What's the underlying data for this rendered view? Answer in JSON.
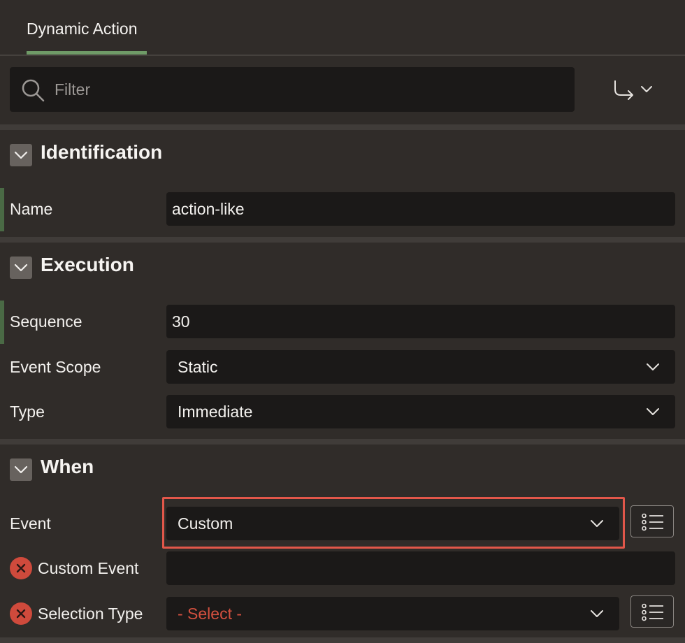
{
  "tabs": {
    "active_label": "Dynamic Action"
  },
  "filter": {
    "placeholder": "Filter"
  },
  "sections": {
    "identification": {
      "title": "Identification",
      "name": {
        "label": "Name",
        "value": "action-like"
      }
    },
    "execution": {
      "title": "Execution",
      "sequence": {
        "label": "Sequence",
        "value": "30"
      },
      "event_scope": {
        "label": "Event Scope",
        "value": "Static"
      },
      "type": {
        "label": "Type",
        "value": "Immediate"
      }
    },
    "when": {
      "title": "When",
      "event": {
        "label": "Event",
        "value": "Custom"
      },
      "custom_event": {
        "label": "Custom Event",
        "value": ""
      },
      "selection_type": {
        "label": "Selection Type",
        "placeholder": "- Select -"
      }
    }
  },
  "colors": {
    "accent": "#6f9b67",
    "error": "#cf4a3c",
    "highlight": "#e2574a",
    "background": "#302c29",
    "field": "#1b1918"
  }
}
